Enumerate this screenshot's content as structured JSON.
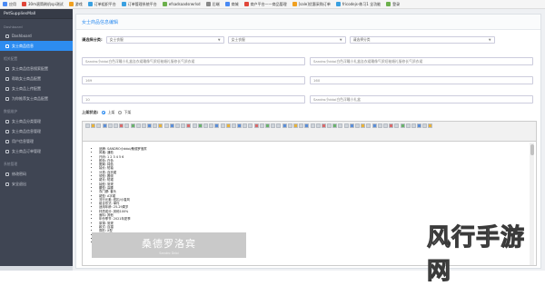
{
  "bookmarks": [
    {
      "label": "应用",
      "color": "#4a8af4"
    },
    {
      "label": "30m滚筒刷机spi测试",
      "color": "#e0463a"
    },
    {
      "label": "游戏",
      "color": "#f0a020"
    },
    {
      "label": "订单组织平台",
      "color": "#3aa0e0"
    },
    {
      "label": "订单管理系统平台",
      "color": "#3aa0e0"
    },
    {
      "label": "efsadsaadsrwrlsd",
      "color": "#6cb04c"
    },
    {
      "label": "后端",
      "color": "#888888"
    },
    {
      "label": "商城",
      "color": "#4a8af4"
    },
    {
      "label": "商户平台——商品管理",
      "color": "#e0463a"
    },
    {
      "label": "[sale]优惠采购订单",
      "color": "#f0a020"
    },
    {
      "label": "fricodejs-练习1 全功能",
      "color": "#3aa0e0"
    },
    {
      "label": "登录",
      "color": "#6cb04c"
    }
  ],
  "sidebar": {
    "brand": "PetSuppliesMall",
    "sections": [
      {
        "title": "Dashboard",
        "items": [
          {
            "label": "Dashboard",
            "active": false
          },
          {
            "label": "女士商品信息",
            "active": true
          }
        ]
      },
      {
        "title": "相关配置",
        "items": [
          {
            "label": "女士商品信息搜索配置",
            "active": false
          },
          {
            "label": "帮助女士商品配置",
            "active": false
          },
          {
            "label": "女士商品上传配置",
            "active": false
          },
          {
            "label": "为你推荐女士商品配置",
            "active": false
          }
        ]
      },
      {
        "title": "数据维护",
        "items": [
          {
            "label": "女士商品分类管理",
            "active": false
          },
          {
            "label": "女士商品信息管理",
            "active": false
          },
          {
            "label": "用户信息管理",
            "active": false
          },
          {
            "label": "女士商品订单管理",
            "active": false
          }
        ]
      },
      {
        "title": "系统管理",
        "items": [
          {
            "label": "修改密码",
            "active": false
          },
          {
            "label": "安全退出",
            "active": false
          }
        ]
      }
    ]
  },
  "form": {
    "title": "女士商品信息编辑",
    "category_label": "请选择分类:",
    "select1": "女士衣服",
    "select2": "女士衣服",
    "select3": "请选择分类",
    "input_name_left": "Sandro小ddoi白色浮雕小礼盒连衣裙雕像气质短袖婚礼服修长气质衣裙",
    "input_name_right": "Sandro小ddoi白色浮雕小礼盒连衣裙雕像气质短袖婚礼服修长气质衣裙",
    "input_price_left": "169",
    "input_price_right": "160",
    "input_stock_left": "10",
    "input_stock_right": "Sandro小ddoi白色浮雕小礼盒",
    "status_label": "上架状态:",
    "radio_on": "上架",
    "radio_off": "下架"
  },
  "editor": {
    "lines": [
      "品牌: SANDRO小ddoi/桑德罗洛宾",
      "风格: 通勤",
      "尺码: 1 2 3 4 5 6",
      "颜色: 白色",
      "图案: 纯色",
      "袖长: 短袖",
      "分类: 连衣裙",
      "领型: 圆领",
      "裙长: 短裙",
      "袖型: 常规",
      "腰型: 高腰",
      "衣门襟: 套头",
      "裙型: A字裙",
      "流行元素: 纽扣/小香风",
      "组合形式: 单件",
      "适用年龄: 25-29周岁",
      "材质成分: 其他100%",
      "面料: 其他",
      "年份季节: 2021年夏季",
      "厚薄: 常规",
      "款式: 百褶",
      "廓形: X型",
      "货号: 2021春夏",
      "颜色: 白色",
      "尺码: 1 2 3"
    ],
    "banner_cn": "桑德罗洛宾",
    "banner_en": "Sandro Ddoi"
  },
  "watermark": "风行手游网"
}
